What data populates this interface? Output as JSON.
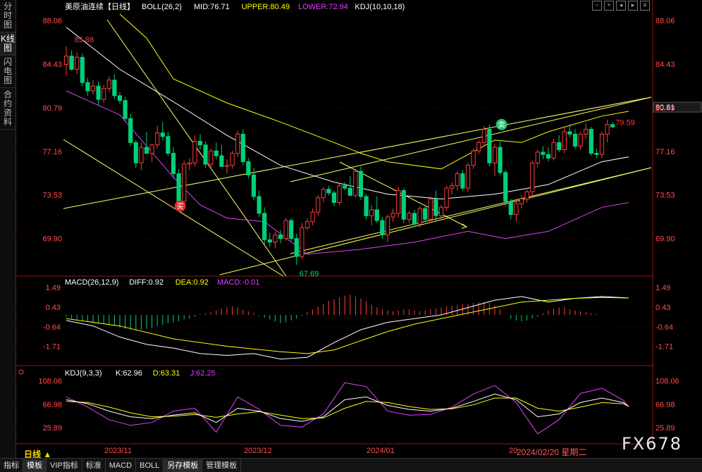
{
  "sidebar": {
    "tabs": [
      "分时图",
      "K线图",
      "闪电图",
      "合约资料"
    ],
    "active_index": 1
  },
  "bottom_tabs": {
    "items": [
      "指标",
      "模板",
      "VIP指标",
      "标准",
      "MACD",
      "BOLL",
      "另存模板",
      "管理模板"
    ],
    "active": [
      1,
      6
    ]
  },
  "period_label": "日线 ▲",
  "crosshair_date": "2024/02/20 星期二",
  "watermark": "FX678",
  "colors": {
    "up": "#ff3b3b",
    "down": "#00d07a",
    "mid": "#ffffff",
    "upper": "#ffff00",
    "lower": "#e040fb",
    "diff": "#ffffff",
    "dea": "#ffff00",
    "j": "#e040fb",
    "trend": "#ffff66",
    "axis": "#ff4d4d",
    "grid": "#3a1010"
  },
  "main_panel": {
    "instrument": "美原油连续【日线】",
    "indicator": "BOLL(26,2)",
    "mid": "MID:76.71",
    "upper": "UPPER:80.49",
    "lower": "LOWER:72.94",
    "kdj_params": "KDJ(10,10,18)",
    "price_ticks": [
      "88.06",
      "84.43",
      "80.79",
      "77.16",
      "73.53",
      "69.90"
    ],
    "high_label": "85.88",
    "low_label": "67.69",
    "last_label": "79.59",
    "crosshair_value": "80.81",
    "buy_sign": "买",
    "sell_sign": "卖"
  },
  "macd_panel": {
    "title": "MACD(26,12,9)",
    "diff": "DIFF:0.92",
    "dea": "DEA:0.92",
    "macd": "MACD:-0.01",
    "ticks": [
      "1.49",
      "0.43",
      "-0.64",
      "-1.71"
    ]
  },
  "kdj_panel": {
    "title": "KDJ(9,3,3)",
    "k": "K:62.96",
    "d": "D:63.31",
    "j": "J:62.25",
    "ticks": [
      "108.06",
      "66.98",
      "25.89"
    ]
  },
  "x_axis": [
    "2023/11",
    "2023/12",
    "2024/01",
    "20"
  ],
  "chart_data": {
    "type": "candlestick",
    "title": "美原油连续【日线】",
    "ylim": [
      67.0,
      88.6
    ],
    "candles": [
      [
        84.4,
        85.9,
        83.5,
        85.1
      ],
      [
        85.1,
        85.6,
        83.9,
        84.0
      ],
      [
        84.0,
        85.4,
        83.6,
        85.0
      ],
      [
        85.0,
        85.3,
        82.6,
        82.9
      ],
      [
        82.9,
        83.3,
        81.8,
        82.2
      ],
      [
        82.2,
        83.1,
        81.9,
        82.6
      ],
      [
        82.6,
        83.0,
        81.0,
        81.5
      ],
      [
        81.5,
        82.7,
        81.2,
        82.4
      ],
      [
        82.4,
        83.4,
        82.1,
        83.1
      ],
      [
        83.1,
        83.6,
        81.5,
        81.8
      ],
      [
        81.8,
        82.1,
        81.1,
        81.4
      ],
      [
        81.4,
        81.7,
        79.6,
        79.9
      ],
      [
        79.9,
        80.3,
        77.6,
        77.9
      ],
      [
        77.9,
        78.1,
        75.8,
        76.2
      ],
      [
        76.2,
        77.9,
        75.6,
        77.5
      ],
      [
        77.5,
        78.8,
        77.1,
        77.0
      ],
      [
        77.0,
        77.8,
        76.3,
        77.7
      ],
      [
        77.7,
        79.3,
        77.4,
        78.7
      ],
      [
        78.7,
        79.6,
        78.1,
        78.4
      ],
      [
        78.4,
        78.8,
        76.8,
        77.0
      ],
      [
        77.0,
        77.5,
        74.9,
        75.3
      ],
      [
        75.3,
        75.7,
        72.8,
        73.0
      ],
      [
        73.0,
        76.4,
        72.7,
        76.1
      ],
      [
        76.1,
        76.6,
        75.6,
        76.2
      ],
      [
        76.2,
        78.5,
        75.9,
        78.0
      ],
      [
        78.0,
        78.6,
        77.3,
        77.7
      ],
      [
        77.7,
        78.0,
        75.8,
        76.1
      ],
      [
        76.1,
        77.4,
        75.8,
        77.2
      ],
      [
        77.2,
        77.9,
        76.5,
        76.8
      ],
      [
        76.8,
        77.7,
        75.9,
        75.9
      ],
      [
        75.9,
        76.5,
        75.3,
        76.0
      ],
      [
        76.0,
        77.2,
        75.7,
        77.0
      ],
      [
        77.0,
        78.9,
        76.7,
        78.6
      ],
      [
        78.6,
        79.0,
        76.0,
        76.3
      ],
      [
        76.3,
        76.6,
        74.9,
        75.2
      ],
      [
        75.2,
        75.8,
        73.1,
        73.4
      ],
      [
        73.4,
        73.9,
        71.7,
        72.0
      ],
      [
        72.0,
        72.5,
        69.4,
        69.8
      ],
      [
        69.8,
        70.4,
        69.2,
        69.6
      ],
      [
        69.6,
        70.5,
        69.1,
        70.2
      ],
      [
        70.2,
        70.6,
        69.5,
        69.9
      ],
      [
        69.9,
        71.6,
        69.7,
        71.4
      ],
      [
        71.4,
        71.6,
        69.7,
        69.9
      ],
      [
        69.9,
        70.3,
        67.7,
        68.4
      ],
      [
        68.4,
        71.2,
        68.2,
        70.8
      ],
      [
        70.8,
        71.6,
        70.6,
        71.3
      ],
      [
        71.3,
        72.4,
        71.0,
        72.1
      ],
      [
        72.1,
        73.5,
        71.8,
        73.3
      ],
      [
        73.3,
        74.2,
        72.9,
        74.0
      ],
      [
        74.0,
        74.3,
        73.5,
        73.7
      ],
      [
        73.7,
        73.9,
        72.6,
        72.9
      ],
      [
        72.9,
        74.5,
        72.7,
        74.3
      ],
      [
        74.3,
        74.6,
        73.9,
        74.1
      ],
      [
        74.1,
        75.1,
        73.4,
        73.5
      ],
      [
        73.5,
        75.7,
        73.3,
        75.5
      ],
      [
        75.5,
        75.9,
        73.1,
        73.4
      ],
      [
        73.4,
        73.6,
        71.5,
        71.8
      ],
      [
        71.8,
        72.7,
        71.0,
        72.3
      ],
      [
        72.3,
        73.4,
        71.2,
        71.4
      ],
      [
        71.4,
        71.7,
        69.9,
        70.2
      ],
      [
        70.2,
        71.9,
        69.6,
        71.7
      ],
      [
        71.7,
        72.4,
        71.3,
        72.0
      ],
      [
        72.0,
        74.2,
        71.6,
        73.9
      ],
      [
        73.9,
        74.1,
        71.2,
        71.5
      ],
      [
        71.5,
        72.2,
        71.2,
        72.0
      ],
      [
        72.0,
        72.3,
        70.9,
        71.1
      ],
      [
        71.1,
        72.6,
        70.8,
        72.4
      ],
      [
        72.4,
        72.7,
        71.3,
        71.5
      ],
      [
        71.5,
        73.4,
        71.2,
        73.2
      ],
      [
        73.2,
        73.9,
        71.3,
        71.8
      ],
      [
        71.8,
        72.7,
        71.4,
        72.5
      ],
      [
        72.5,
        74.3,
        72.2,
        74.1
      ],
      [
        74.1,
        74.6,
        73.6,
        74.3
      ],
      [
        74.3,
        75.5,
        73.9,
        75.3
      ],
      [
        75.3,
        75.6,
        73.9,
        74.1
      ],
      [
        74.1,
        76.2,
        73.8,
        76.0
      ],
      [
        76.0,
        77.4,
        75.7,
        77.2
      ],
      [
        77.2,
        78.1,
        76.9,
        77.9
      ],
      [
        77.9,
        79.3,
        77.6,
        79.0
      ],
      [
        79.0,
        79.4,
        75.9,
        76.2
      ],
      [
        76.2,
        77.8,
        75.1,
        77.5
      ],
      [
        77.5,
        78.1,
        75.2,
        75.4
      ],
      [
        75.4,
        75.6,
        72.6,
        73.0
      ],
      [
        73.0,
        73.2,
        71.5,
        71.9
      ],
      [
        71.9,
        73.1,
        71.3,
        72.8
      ],
      [
        72.8,
        73.5,
        72.4,
        73.2
      ],
      [
        73.2,
        74.0,
        72.9,
        73.8
      ],
      [
        73.8,
        76.4,
        73.5,
        76.2
      ],
      [
        76.2,
        77.3,
        75.8,
        77.1
      ],
      [
        77.1,
        77.6,
        76.5,
        76.9
      ],
      [
        76.9,
        77.5,
        76.3,
        76.6
      ],
      [
        76.6,
        78.2,
        76.4,
        77.9
      ],
      [
        77.9,
        78.5,
        77.1,
        77.3
      ],
      [
        77.3,
        79.2,
        77.0,
        78.8
      ],
      [
        78.8,
        79.4,
        78.3,
        78.6
      ],
      [
        78.6,
        79.0,
        77.4,
        77.6
      ],
      [
        77.6,
        78.8,
        77.3,
        78.6
      ],
      [
        78.6,
        79.5,
        78.2,
        79.0
      ],
      [
        79.0,
        79.2,
        76.8,
        77.0
      ],
      [
        77.0,
        77.4,
        76.6,
        76.9
      ],
      [
        76.9,
        78.8,
        76.6,
        78.6
      ],
      [
        78.6,
        79.8,
        77.9,
        79.4
      ],
      [
        79.4,
        79.6,
        79.1,
        79.2
      ]
    ],
    "boll": {
      "mid": [
        [
          0,
          87.5
        ],
        [
          10,
          84.0
        ],
        [
          20,
          81.3
        ],
        [
          30,
          78.5
        ],
        [
          40,
          76.0
        ],
        [
          50,
          74.6
        ],
        [
          60,
          73.6
        ],
        [
          70,
          73.2
        ],
        [
          80,
          73.6
        ],
        [
          90,
          74.4
        ],
        [
          100,
          76.3
        ],
        [
          105,
          76.7
        ]
      ],
      "upper": [
        [
          10,
          88.6
        ],
        [
          15,
          86.6
        ],
        [
          20,
          83.2
        ],
        [
          30,
          81.2
        ],
        [
          40,
          79.6
        ],
        [
          50,
          77.9
        ],
        [
          55,
          77.0
        ],
        [
          60,
          76.3
        ],
        [
          70,
          75.7
        ],
        [
          80,
          78.1
        ],
        [
          85,
          77.9
        ],
        [
          90,
          78.8
        ],
        [
          100,
          80.1
        ],
        [
          105,
          80.5
        ]
      ],
      "lower": [
        [
          0,
          82.2
        ],
        [
          10,
          80.2
        ],
        [
          20,
          75.0
        ],
        [
          25,
          72.7
        ],
        [
          30,
          71.6
        ],
        [
          37,
          71.3
        ],
        [
          45,
          68.6
        ],
        [
          55,
          69.0
        ],
        [
          65,
          69.6
        ],
        [
          75,
          70.5
        ],
        [
          82,
          69.9
        ],
        [
          90,
          70.5
        ],
        [
          100,
          72.5
        ],
        [
          105,
          72.9
        ]
      ]
    },
    "macd": {
      "diff": [
        [
          0,
          -0.3
        ],
        [
          5,
          -0.6
        ],
        [
          10,
          -1.2
        ],
        [
          15,
          -1.6
        ],
        [
          20,
          -1.8
        ],
        [
          25,
          -2.1
        ],
        [
          30,
          -2.2
        ],
        [
          35,
          -2.1
        ],
        [
          40,
          -2.4
        ],
        [
          45,
          -2.3
        ],
        [
          50,
          -1.5
        ],
        [
          55,
          -0.8
        ],
        [
          60,
          -0.4
        ],
        [
          65,
          -0.2
        ],
        [
          70,
          0.0
        ],
        [
          75,
          0.4
        ],
        [
          80,
          0.8
        ],
        [
          85,
          1.0
        ],
        [
          90,
          0.7
        ],
        [
          95,
          0.9
        ],
        [
          100,
          1.0
        ],
        [
          105,
          0.92
        ]
      ],
      "dea": [
        [
          0,
          -0.2
        ],
        [
          10,
          -0.6
        ],
        [
          20,
          -1.3
        ],
        [
          30,
          -1.7
        ],
        [
          40,
          -2.0
        ],
        [
          45,
          -2.1
        ],
        [
          50,
          -1.9
        ],
        [
          55,
          -1.4
        ],
        [
          60,
          -0.9
        ],
        [
          65,
          -0.5
        ],
        [
          70,
          -0.2
        ],
        [
          75,
          0.1
        ],
        [
          80,
          0.4
        ],
        [
          85,
          0.7
        ],
        [
          90,
          0.8
        ],
        [
          95,
          0.9
        ],
        [
          100,
          0.95
        ],
        [
          105,
          0.92
        ]
      ],
      "histogram": [
        -0.1,
        -0.2,
        -0.25,
        -0.3,
        -0.35,
        -0.4,
        -0.45,
        -0.5,
        -0.55,
        -0.6,
        -0.7,
        -0.75,
        -0.8,
        -0.85,
        -0.8,
        -0.75,
        -0.7,
        -0.6,
        -0.55,
        -0.45,
        -0.4,
        -0.35,
        -0.25,
        -0.2,
        -0.1,
        0.05,
        0.1,
        0.15,
        0.25,
        0.35,
        0.4,
        0.45,
        0.4,
        0.3,
        0.2,
        0.1,
        -0.05,
        -0.15,
        -0.25,
        -0.35,
        -0.45,
        -0.4,
        -0.3,
        -0.2,
        -0.05,
        0.15,
        0.3,
        0.45,
        0.6,
        0.75,
        0.85,
        0.95,
        1.05,
        1.1,
        1.0,
        0.9,
        0.75,
        0.55,
        0.4,
        0.3,
        0.25,
        0.2,
        0.25,
        0.3,
        0.3,
        0.25,
        0.2,
        0.25,
        0.3,
        0.35,
        0.4,
        0.45,
        0.5,
        0.55,
        0.6,
        0.6,
        0.65,
        0.7,
        0.7,
        0.65,
        0.5,
        0.3,
        0.0,
        -0.2,
        -0.3,
        -0.35,
        -0.3,
        -0.2,
        -0.1,
        0.1,
        0.25,
        0.35,
        0.4,
        0.4,
        0.3,
        0.25,
        0.2,
        0.15,
        0.1,
        0.05,
        0.0,
        0.0,
        -0.01,
        -0.01,
        -0.01,
        -0.01
      ]
    },
    "kdj": {
      "k": [
        [
          0,
          75
        ],
        [
          4,
          68
        ],
        [
          8,
          55
        ],
        [
          12,
          45
        ],
        [
          16,
          42
        ],
        [
          20,
          48
        ],
        [
          24,
          52
        ],
        [
          28,
          35
        ],
        [
          32,
          60
        ],
        [
          36,
          55
        ],
        [
          40,
          42
        ],
        [
          44,
          37
        ],
        [
          48,
          45
        ],
        [
          52,
          75
        ],
        [
          56,
          80
        ],
        [
          60,
          65
        ],
        [
          64,
          58
        ],
        [
          68,
          55
        ],
        [
          72,
          60
        ],
        [
          76,
          72
        ],
        [
          80,
          85
        ],
        [
          84,
          75
        ],
        [
          88,
          45
        ],
        [
          92,
          50
        ],
        [
          96,
          70
        ],
        [
          100,
          78
        ],
        [
          104,
          70
        ],
        [
          105,
          62.96
        ]
      ],
      "d": [
        [
          0,
          72
        ],
        [
          4,
          70
        ],
        [
          8,
          62
        ],
        [
          12,
          52
        ],
        [
          16,
          45
        ],
        [
          20,
          46
        ],
        [
          24,
          49
        ],
        [
          28,
          44
        ],
        [
          32,
          50
        ],
        [
          36,
          54
        ],
        [
          40,
          48
        ],
        [
          44,
          42
        ],
        [
          48,
          43
        ],
        [
          52,
          60
        ],
        [
          56,
          72
        ],
        [
          60,
          70
        ],
        [
          64,
          63
        ],
        [
          68,
          58
        ],
        [
          72,
          59
        ],
        [
          76,
          66
        ],
        [
          80,
          78
        ],
        [
          84,
          78
        ],
        [
          88,
          60
        ],
        [
          92,
          55
        ],
        [
          96,
          62
        ],
        [
          100,
          70
        ],
        [
          104,
          68
        ],
        [
          105,
          63.31
        ]
      ],
      "j": [
        [
          0,
          80
        ],
        [
          4,
          62
        ],
        [
          8,
          40
        ],
        [
          12,
          30
        ],
        [
          16,
          35
        ],
        [
          20,
          55
        ],
        [
          24,
          60
        ],
        [
          28,
          18
        ],
        [
          32,
          80
        ],
        [
          36,
          58
        ],
        [
          40,
          30
        ],
        [
          44,
          27
        ],
        [
          48,
          50
        ],
        [
          52,
          105
        ],
        [
          56,
          98
        ],
        [
          60,
          55
        ],
        [
          64,
          48
        ],
        [
          68,
          49
        ],
        [
          72,
          62
        ],
        [
          76,
          85
        ],
        [
          80,
          100
        ],
        [
          84,
          70
        ],
        [
          88,
          15
        ],
        [
          92,
          40
        ],
        [
          96,
          86
        ],
        [
          100,
          95
        ],
        [
          104,
          74
        ],
        [
          105,
          62.25
        ]
      ]
    }
  }
}
